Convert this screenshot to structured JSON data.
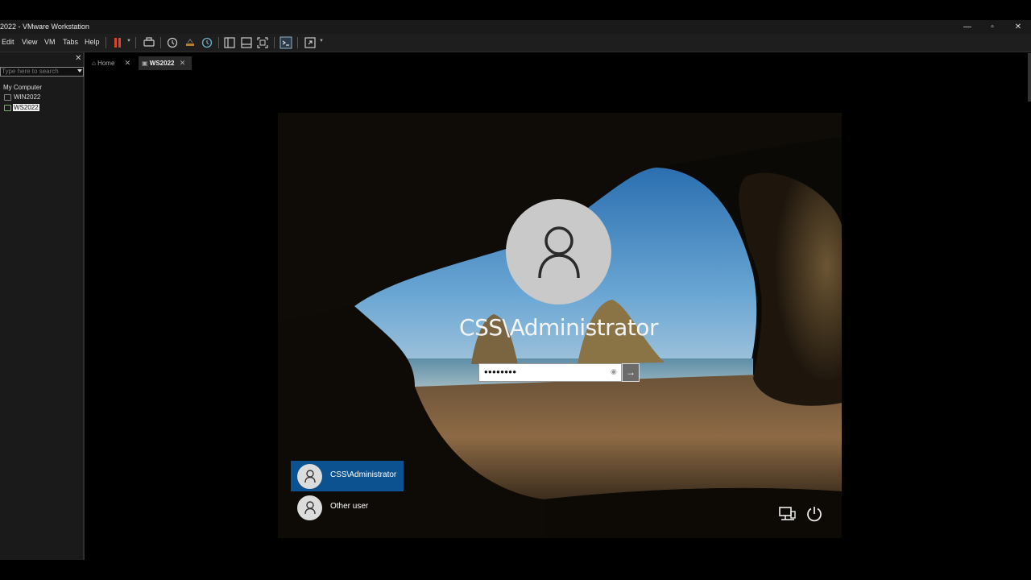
{
  "window": {
    "title": "2022 - VMware Workstation",
    "minimize": "—",
    "restore": "▫",
    "close": "✕"
  },
  "menu": {
    "edit": "Edit",
    "view": "View",
    "vm": "VM",
    "tabs": "Tabs",
    "help": "Help"
  },
  "library": {
    "close": "✕",
    "search_placeholder": "Type here to search",
    "root": "My Computer",
    "items": [
      {
        "label": "WIN2022"
      },
      {
        "label": "WS2022"
      }
    ]
  },
  "tabs": [
    {
      "label": "Home"
    },
    {
      "label": "WS2022"
    }
  ],
  "tab_close": "✕",
  "login": {
    "username": "CSS\\Administrator",
    "password_mask": "••••••••",
    "users": [
      {
        "label": "CSS\\Administrator"
      },
      {
        "label": "Other user"
      }
    ]
  },
  "colors": {
    "selected_user": "#0c5291",
    "pause": "#d9452b"
  }
}
